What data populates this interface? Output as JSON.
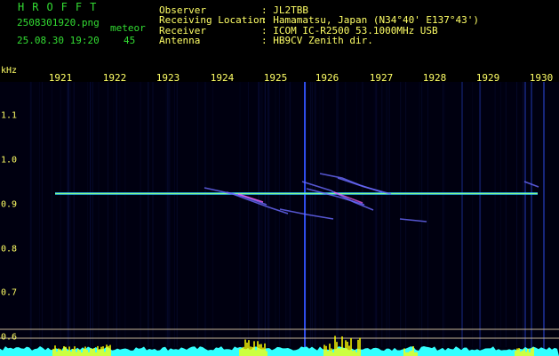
{
  "app": {
    "brand": "HROFFT",
    "file_name": "2508301920.png",
    "datetime": "25.08.30 19:20",
    "meteor_label": "meteor",
    "meteor_count": "45"
  },
  "info": {
    "rows": [
      {
        "label": "Observer",
        "value": ": JL2TBB"
      },
      {
        "label": "Receiving Location",
        "value": ": Hamamatsu, Japan (N34°40' E137°43')"
      },
      {
        "label": "Receiver",
        "value": ": ICOM IC-R2500 53.1000MHz USB"
      },
      {
        "label": "Antenna",
        "value": ": HB9CV Zenith dir."
      }
    ]
  },
  "spectrogram": {
    "unit_label": "kHz",
    "time_labels": [
      "1921",
      "1922",
      "1923",
      "1924",
      "1925",
      "1926",
      "1927",
      "1928",
      "1929",
      "1930"
    ],
    "freq_labels": [
      "1.1",
      "1.0",
      "0.9",
      "0.8",
      "0.7",
      "0.6"
    ],
    "carrier_khz": 0.925,
    "colors": {
      "background": "#000010",
      "grid": "#000080",
      "carrier": "#33ccff",
      "carrier_core": "#88ff88",
      "labels": "#ffff66",
      "level_fill": "#33ffff",
      "level_peaks": "#ffff00",
      "divider": "#c8b89a"
    }
  }
}
